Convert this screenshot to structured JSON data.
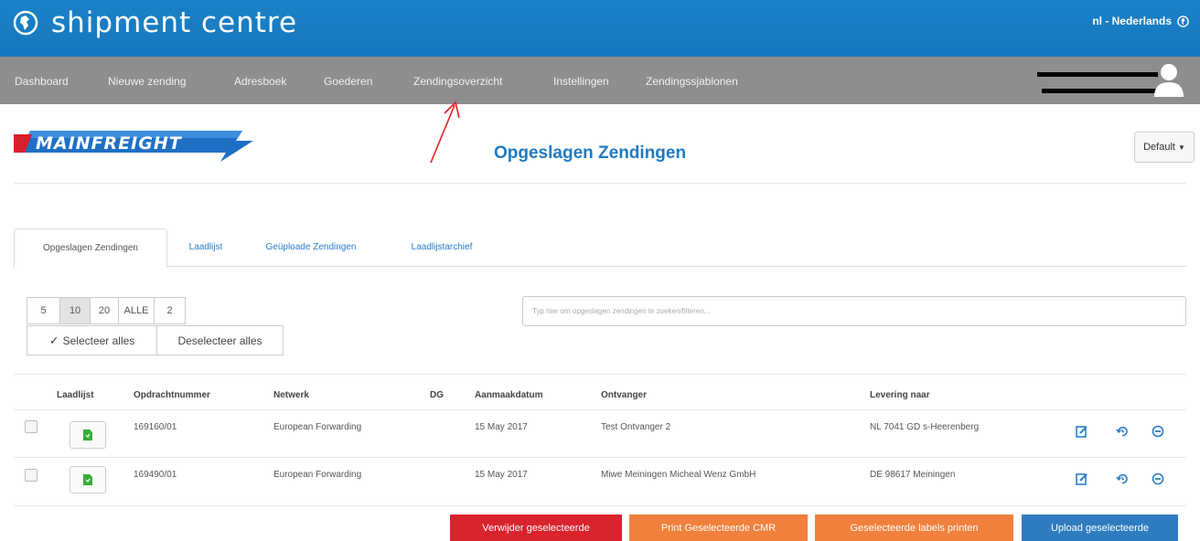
{
  "app": {
    "title": "shipment centre",
    "language": "nl - Nederlands"
  },
  "nav": {
    "items": [
      "Dashboard",
      "Nieuwe zending",
      "Adresboek",
      "Goederen",
      "Zendingsoverzicht",
      "Instellingen",
      "Zendingssjablonen"
    ]
  },
  "page": {
    "title": "Opgeslagen Zendingen",
    "default_label": "Default",
    "logo_text": "MAINFREIGHT"
  },
  "tabs": [
    "Opgeslagen Zendingen",
    "Laadlijst",
    "Geüploade Zendingen",
    "Laadlijstarchief"
  ],
  "pager": {
    "sizes": [
      "5",
      "10",
      "20",
      "ALLE"
    ],
    "active": "10",
    "pages": "2"
  },
  "selection": {
    "select_all": "Selecteer alles",
    "deselect_all": "Deselecteer alles"
  },
  "search": {
    "placeholder": "Typ hier om opgeslagen zendingen te zoeken/filteren..."
  },
  "table": {
    "columns": [
      "Laadlijst",
      "Opdrachtnummer",
      "Netwerk",
      "DG",
      "Aanmaakdatum",
      "Ontvanger",
      "Levering naar"
    ],
    "rows": [
      {
        "order": "169160/01",
        "network": "European Forwarding",
        "dg": "",
        "date": "15 May 2017",
        "receiver": "Test Ontvanger 2",
        "delivery": "NL 7041 GD s-Heerenberg"
      },
      {
        "order": "169490/01",
        "network": "European Forwarding",
        "dg": "",
        "date": "15 May 2017",
        "receiver": "Miwe Meiningen Micheal Wenz GmbH",
        "delivery": "DE 98617 Meiningen"
      }
    ]
  },
  "buttons": {
    "delete": "Verwijder geselecteerde",
    "print_cmr": "Print Geselecteerde CMR",
    "print_labels": "Geselecteerde labels printen",
    "upload": "Upload geselecteerde"
  },
  "colors": {
    "topbar": "#1a82c8",
    "navbar": "#8e8e8e",
    "accent": "#1f7ac2",
    "delete": "#d9232d",
    "orange": "#f0803c",
    "upload": "#2f7bbf",
    "green_icon": "#3aab3a"
  },
  "icons": [
    "globe-icon",
    "user-icon",
    "caret-down-icon",
    "check-icon",
    "file-icon",
    "edit-icon",
    "restore-icon",
    "remove-icon"
  ]
}
